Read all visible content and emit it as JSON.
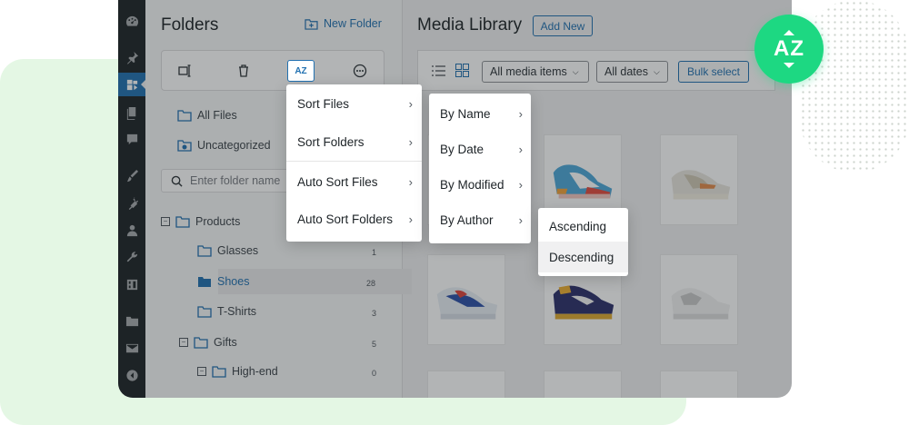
{
  "folders_panel": {
    "title": "Folders",
    "new_folder": "New Folder",
    "sort_tool_label": "AZ",
    "search_placeholder": "Enter folder name",
    "all_files": "All Files",
    "uncategorized": "Uncategorized",
    "tree": [
      {
        "label": "Products",
        "count": ""
      },
      {
        "label": "Glasses",
        "count": "1"
      },
      {
        "label": "Shoes",
        "count": "28"
      },
      {
        "label": "T-Shirts",
        "count": "3"
      },
      {
        "label": "Gifts",
        "count": "5"
      },
      {
        "label": "High-end",
        "count": "0"
      }
    ]
  },
  "media_panel": {
    "title": "Media Library",
    "add_new": "Add New",
    "filter_type": "All media items",
    "filter_date": "All dates",
    "bulk_select": "Bulk select"
  },
  "sort_menu": {
    "items": [
      "Sort Files",
      "Sort Folders",
      "Auto Sort Files",
      "Auto Sort Folders"
    ]
  },
  "by_menu": {
    "items": [
      "By Name",
      "By Date",
      "By Modified",
      "By Author"
    ]
  },
  "order_menu": {
    "items": [
      "Ascending",
      "Descending"
    ]
  },
  "badge": {
    "text": "AZ",
    "color": "#1dd882"
  },
  "icons": {
    "admin_bar": [
      "dashboard-icon",
      "pin-icon",
      "media-icon",
      "pages-icon",
      "comments-icon",
      "appearance-icon",
      "plugins-icon",
      "users-icon",
      "tools-icon",
      "settings-icon",
      "folder-icon",
      "mail-icon",
      "collapse-icon"
    ]
  }
}
